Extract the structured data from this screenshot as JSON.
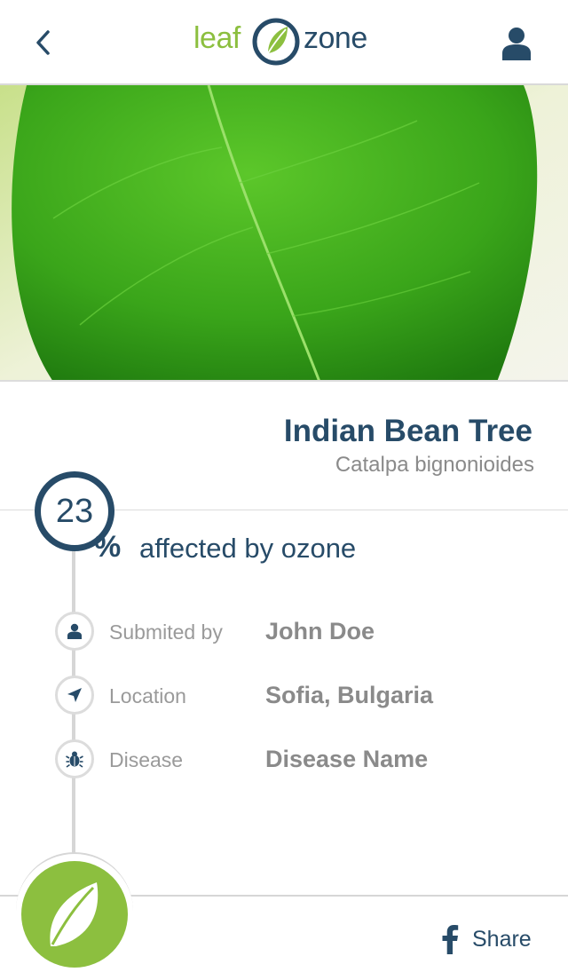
{
  "header": {
    "logo_left": "leaf",
    "logo_right": "zone",
    "back_icon": "chevron-left-icon",
    "profile_icon": "user-icon"
  },
  "plant": {
    "common_name": "Indian Bean Tree",
    "scientific_name": "Catalpa bignonioides",
    "image": "green-leaf-photo"
  },
  "ozone": {
    "value": "23",
    "unit": "%",
    "label": "affected by ozone"
  },
  "details": [
    {
      "icon": "user-icon",
      "label": "Submited by",
      "value": "John Doe"
    },
    {
      "icon": "location-arrow-icon",
      "label": "Location",
      "value": "Sofia, Bulgaria"
    },
    {
      "icon": "bug-icon",
      "label": "Disease",
      "value": "Disease Name"
    }
  ],
  "footer": {
    "share_label": "Share",
    "share_icon": "facebook-icon",
    "fab_icon": "leaf-icon"
  },
  "colors": {
    "brand_green": "#8cbf3f",
    "brand_navy": "#274b68",
    "muted_text": "#8a8a8a"
  }
}
